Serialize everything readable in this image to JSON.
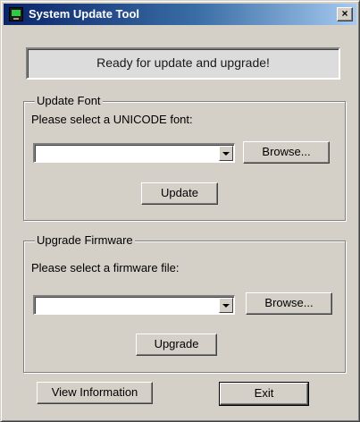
{
  "window": {
    "title": "System Update Tool",
    "close_glyph": "×"
  },
  "status": {
    "message": "Ready for update and upgrade!"
  },
  "update_font": {
    "group_label": "Update Font",
    "prompt": "Please select a UNICODE font:",
    "selected_value": "",
    "browse_label": "Browse...",
    "action_label": "Update"
  },
  "upgrade_firmware": {
    "group_label": "Upgrade Firmware",
    "prompt": "Please select a firmware file:",
    "selected_value": "",
    "browse_label": "Browse...",
    "action_label": "Upgrade"
  },
  "footer": {
    "view_info_label": "View Information",
    "exit_label": "Exit"
  },
  "icons": {
    "app": "monitor-icon",
    "close": "close-icon",
    "dropdown": "chevron-down-icon"
  },
  "colors": {
    "title_bar_start": "#0a246a",
    "title_bar_end": "#a6caf0",
    "dialog_face": "#d4d0c8"
  }
}
